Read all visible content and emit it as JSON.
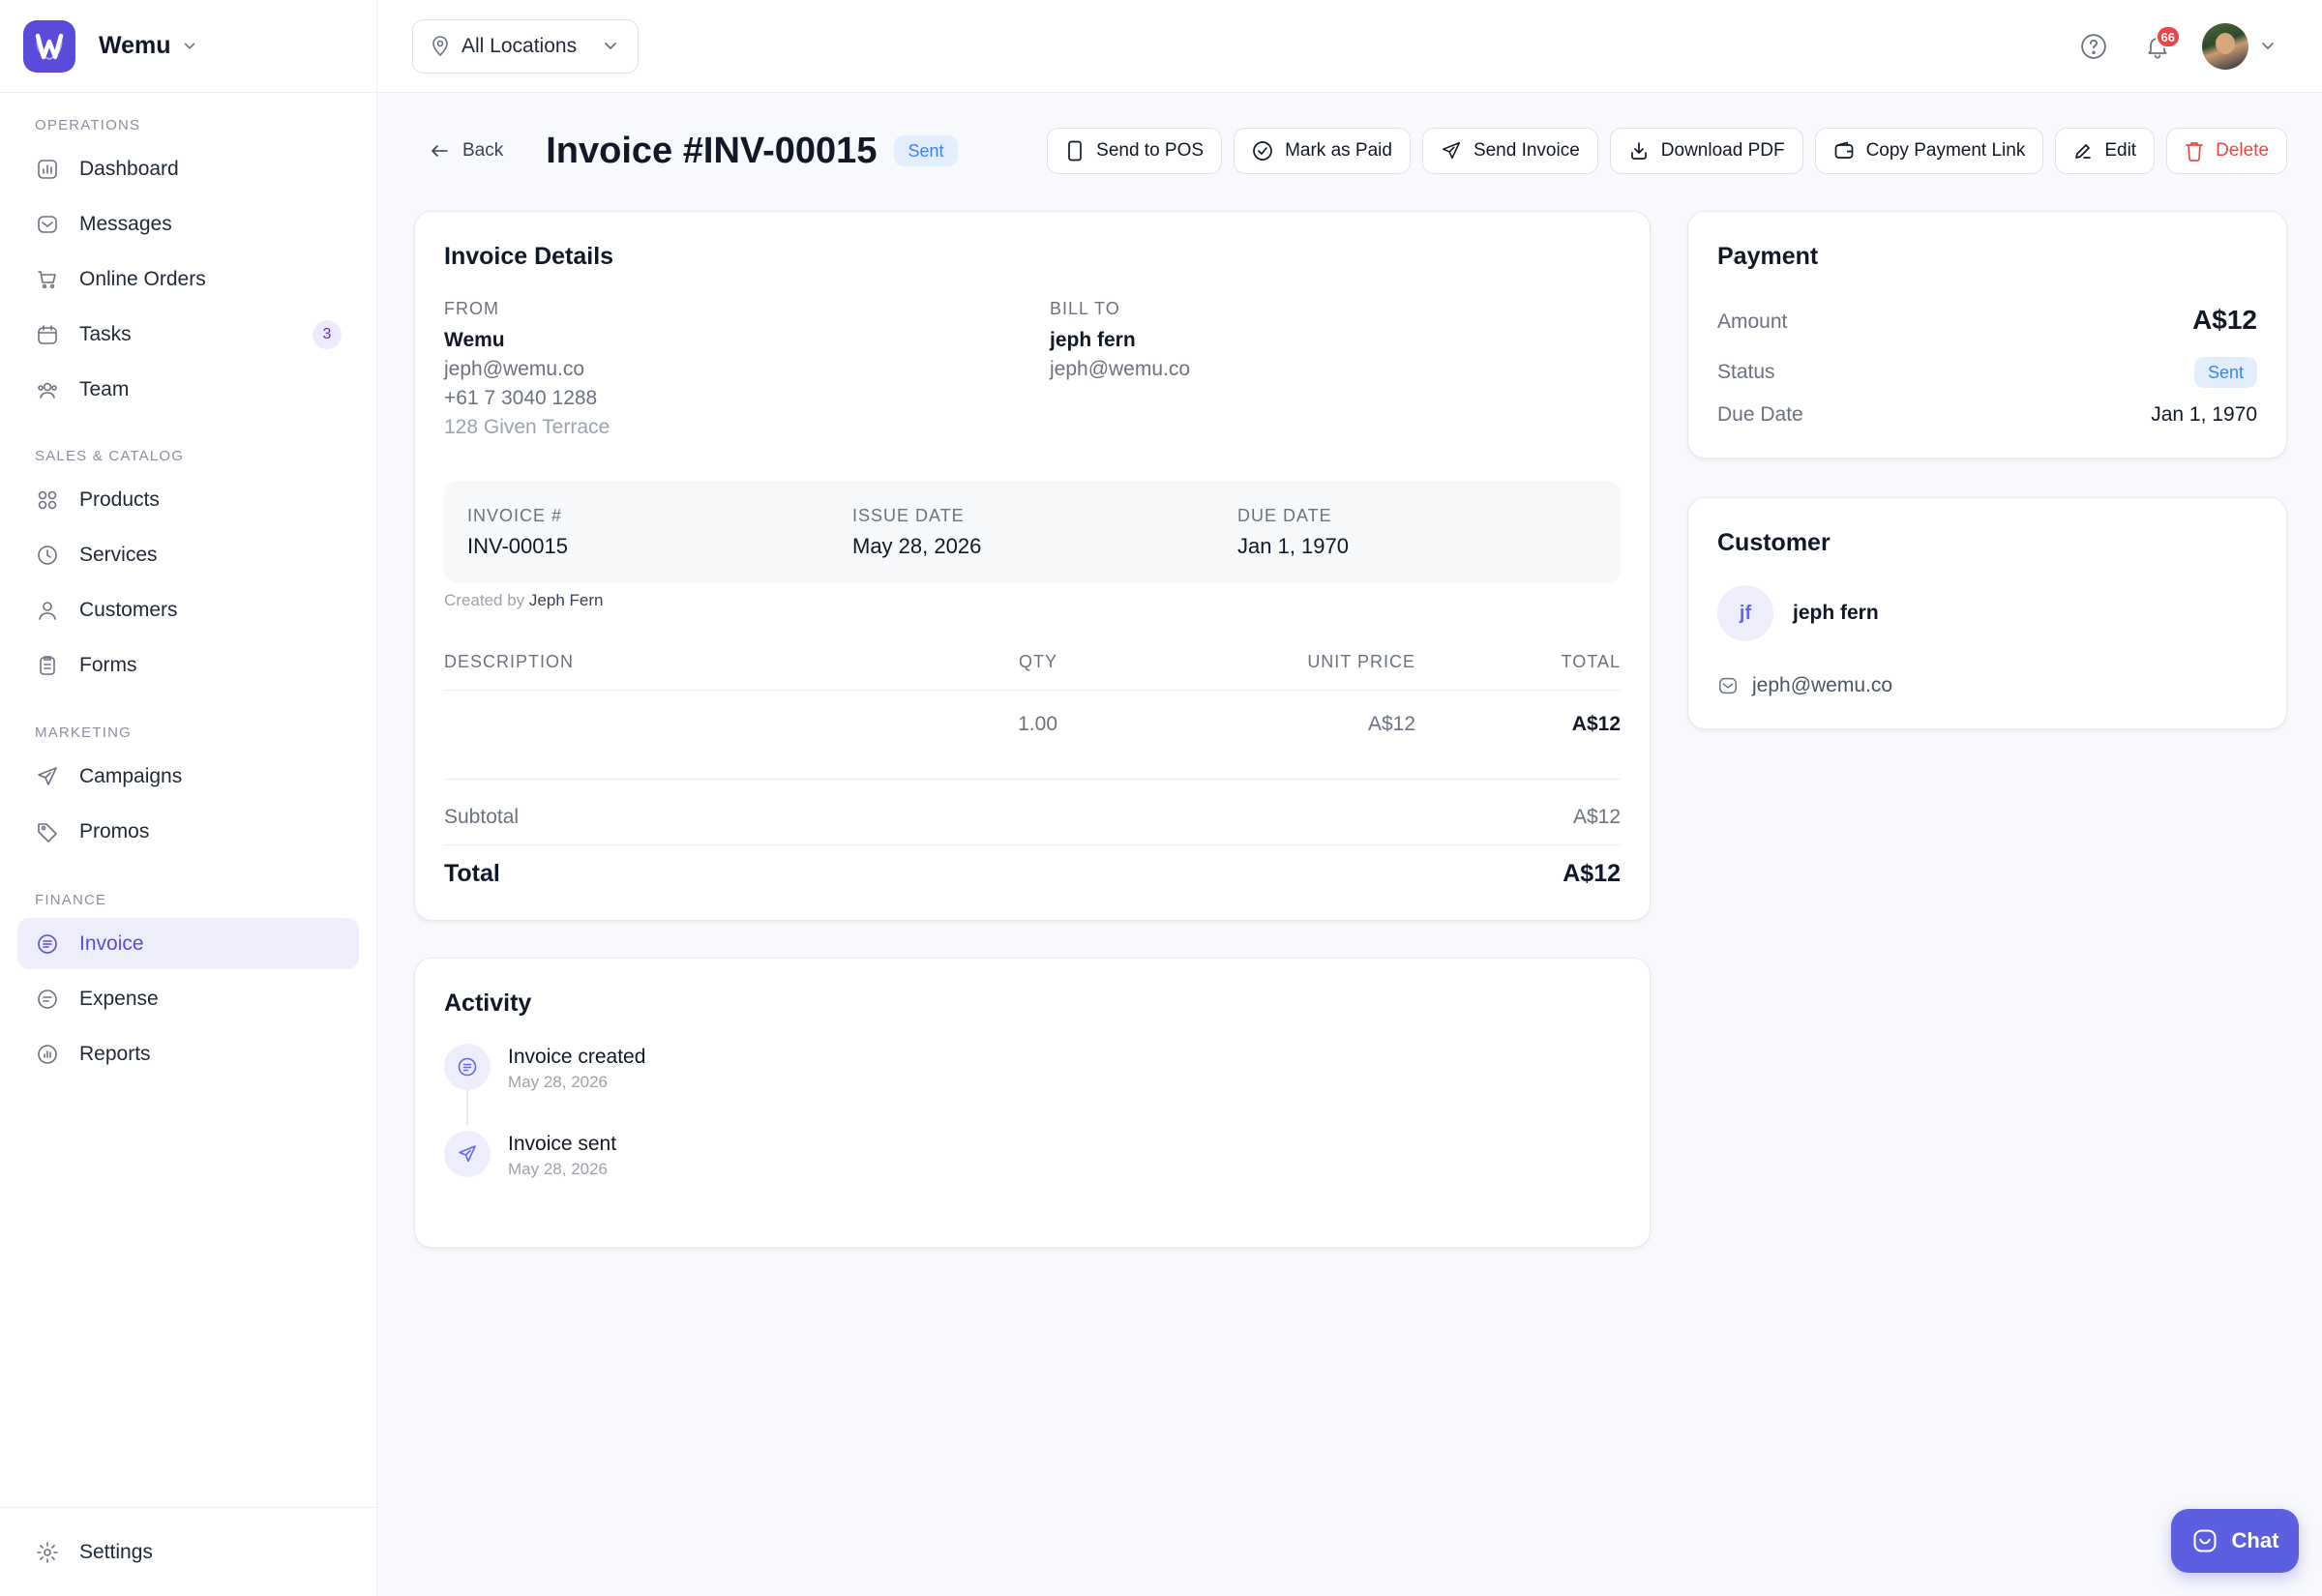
{
  "brand": {
    "name": "Wemu",
    "logo_icon": "wemu-logo-icon",
    "accent": "#5b4bdb"
  },
  "sidebar": {
    "sections": [
      {
        "label": "OPERATIONS",
        "items": [
          {
            "label": "Dashboard",
            "icon": "chart-icon"
          },
          {
            "label": "Messages",
            "icon": "inbox-icon"
          },
          {
            "label": "Online Orders",
            "icon": "cart-icon"
          },
          {
            "label": "Tasks",
            "icon": "calendar-icon",
            "badge": "3"
          },
          {
            "label": "Team",
            "icon": "team-icon"
          }
        ]
      },
      {
        "label": "SALES & CATALOG",
        "items": [
          {
            "label": "Products",
            "icon": "grid-icon"
          },
          {
            "label": "Services",
            "icon": "clock-icon"
          },
          {
            "label": "Customers",
            "icon": "user-icon"
          },
          {
            "label": "Forms",
            "icon": "clipboard-icon"
          }
        ]
      },
      {
        "label": "MARKETING",
        "items": [
          {
            "label": "Campaigns",
            "icon": "send-icon"
          },
          {
            "label": "Promos",
            "icon": "tag-icon"
          }
        ]
      },
      {
        "label": "FINANCE",
        "items": [
          {
            "label": "Invoice",
            "icon": "invoice-icon",
            "active": true
          },
          {
            "label": "Expense",
            "icon": "expense-icon"
          },
          {
            "label": "Reports",
            "icon": "chart-icon"
          }
        ]
      }
    ],
    "footer": {
      "label": "Settings",
      "icon": "gear-icon"
    }
  },
  "topbar": {
    "location": "All Locations",
    "notification_count": "66"
  },
  "page": {
    "back_label": "Back",
    "title": "Invoice #INV-00015",
    "status": "Sent",
    "actions": [
      {
        "label": "Send to POS",
        "icon": "device-icon"
      },
      {
        "label": "Mark as Paid",
        "icon": "check-circle-icon"
      },
      {
        "label": "Send Invoice",
        "icon": "send-icon"
      },
      {
        "label": "Download PDF",
        "icon": "download-icon"
      },
      {
        "label": "Copy Payment Link",
        "icon": "wallet-icon"
      },
      {
        "label": "Edit",
        "icon": "pencil-icon"
      },
      {
        "label": "Delete",
        "icon": "trash-icon",
        "danger": true
      }
    ]
  },
  "invoice_details": {
    "title": "Invoice Details",
    "from_label": "FROM",
    "from_name": "Wemu",
    "from_email": "jeph@wemu.co",
    "from_phone": "+61 7 3040 1288",
    "from_address": "128 Given Terrace",
    "bill_label": "BILL TO",
    "bill_name": "jeph fern",
    "bill_email": "jeph@wemu.co",
    "invoice_no_label": "INVOICE #",
    "invoice_no": "INV-00015",
    "issue_label": "ISSUE DATE",
    "issue_date": "May 28, 2026",
    "due_label": "DUE DATE",
    "due_date": "Jan 1, 1970",
    "created_by_prefix": "Created by",
    "created_by": "Jeph Fern",
    "columns": [
      "DESCRIPTION",
      "QTY",
      "UNIT PRICE",
      "TOTAL"
    ],
    "line": {
      "description": "",
      "qty": "1.00",
      "unit_price": "A$12",
      "total": "A$12"
    },
    "subtotal_label": "Subtotal",
    "subtotal": "A$12",
    "total_label": "Total",
    "total": "A$12"
  },
  "activity": {
    "title": "Activity",
    "events": [
      {
        "title": "Invoice created",
        "date": "May 28, 2026",
        "icon": "invoice-icon"
      },
      {
        "title": "Invoice sent",
        "date": "May 28, 2026",
        "icon": "send-icon"
      }
    ]
  },
  "payment": {
    "title": "Payment",
    "amount_label": "Amount",
    "amount": "A$12",
    "status_label": "Status",
    "status": "Sent",
    "due_label": "Due Date",
    "due_date": "Jan 1, 1970"
  },
  "customer": {
    "title": "Customer",
    "initials": "jf",
    "name": "jeph fern",
    "email": "jeph@wemu.co"
  },
  "chat": {
    "label": "Chat"
  }
}
